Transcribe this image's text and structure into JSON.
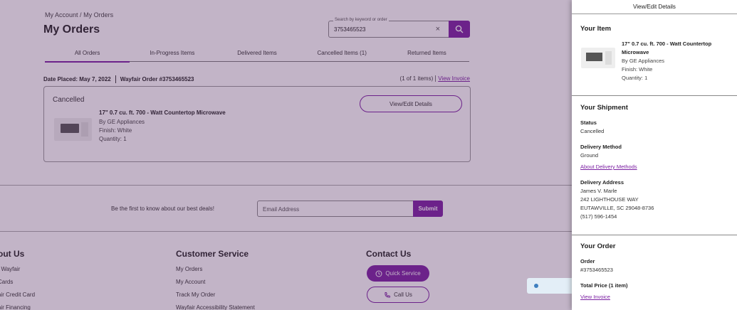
{
  "breadcrumb": {
    "account": "My Account",
    "separator": "/",
    "orders": "My Orders"
  },
  "page_title": "My Orders",
  "search": {
    "label": "Search by keyword or order",
    "value": "3753465523",
    "clear": "×"
  },
  "tabs": [
    {
      "label": "All Orders",
      "active": true
    },
    {
      "label": "In-Progress Items",
      "active": false
    },
    {
      "label": "Delivered Items",
      "active": false
    },
    {
      "label": "Cancelled Items (1)",
      "active": false
    },
    {
      "label": "Returned Items",
      "active": false
    }
  ],
  "order": {
    "date_placed": "Date Placed: May 7, 2022",
    "order_number": "Wayfair Order #3753465523",
    "item_count": "(1 of 1 items)",
    "invoice_link": "View Invoice",
    "status": "Cancelled",
    "button": "View/Edit Details",
    "item": {
      "name": "17\" 0.7 cu. ft. 700 - Watt Countertop Microwave",
      "brand": "By GE Appliances",
      "finish": "Finish: White",
      "quantity": "Quantity: 1"
    }
  },
  "newsletter": {
    "text": "Be the first to know about our best deals!",
    "placeholder": "Email Address",
    "button": "Submit"
  },
  "footer": {
    "about": {
      "heading": "out Us",
      "links": [
        "t Wayfair",
        "Cards",
        "air Credit Card",
        "air Financing"
      ]
    },
    "service": {
      "heading": "Customer Service",
      "links": [
        "My Orders",
        "My Account",
        "Track My Order",
        "Wayfair Accessibility Statement"
      ]
    },
    "contact": {
      "heading": "Contact Us",
      "quick_service": "Quick Service",
      "call_us": "Call Us"
    }
  },
  "drawer": {
    "title": "View/Edit Details",
    "your_item": {
      "heading": "Your Item",
      "name_line1": "17\" 0.7 cu. ft. 700 - Watt Countertop",
      "name_line2": "Microwave",
      "brand": "By GE Appliances",
      "finish": "Finish: White",
      "quantity": "Quantity: 1"
    },
    "shipment": {
      "heading": "Your Shipment",
      "status_label": "Status",
      "status_value": "Cancelled",
      "method_label": "Delivery Method",
      "method_value": "Ground",
      "methods_link": "About Delivery Methods",
      "address_label": "Delivery Address",
      "address_lines": [
        "James V. Marle",
        "242 LIGHTHOUSE WAY",
        "EUTAWVILLE, SC 29048-8736",
        "(517) 596-1454"
      ]
    },
    "your_order": {
      "heading": "Your Order",
      "order_label": "Order",
      "order_value": "#3753465523",
      "total_label": "Total Price (1 item)",
      "invoice_link": "View Invoice"
    }
  },
  "colors": {
    "accent": "#7b1fa2",
    "overlay": "#50285f"
  }
}
